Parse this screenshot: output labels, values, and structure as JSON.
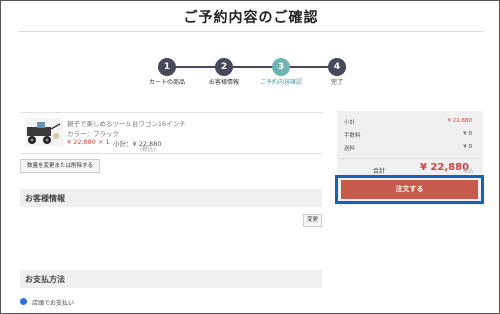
{
  "page_title": "ご予約内容のご確認",
  "steps": [
    {
      "number": "1",
      "label": "カートの商品",
      "current": false
    },
    {
      "number": "2",
      "label": "お客様情報",
      "current": false
    },
    {
      "number": "3",
      "label": "ご予約内容確認",
      "current": true
    },
    {
      "number": "4",
      "label": "完了",
      "current": false
    }
  ],
  "product": {
    "name_line1": "親子で楽しめるツール台ワゴン16インチ",
    "name_line2": "カラー：ブラック",
    "price_qty": "¥ 22,880 × 1",
    "subtotal": "小計：¥ 22,880",
    "tax_note": "(税込)"
  },
  "change_qty_button": "数量を変更または削除する",
  "customer_section": {
    "title": "お客様情報",
    "change_button": "変更"
  },
  "payment_section": {
    "title": "お支払方法",
    "option": "店頭でお支払い"
  },
  "summary": {
    "rows": [
      {
        "label": "小計",
        "value": "¥ 22,880",
        "red": true
      },
      {
        "label": "手数料",
        "value": "¥ 0",
        "red": false
      },
      {
        "label": "送料",
        "value": "¥ 0",
        "red": false
      }
    ],
    "total_label": "合計",
    "total_value": "¥ 22,880",
    "total_tax": "税込",
    "order_button": "注文する"
  },
  "colors": {
    "step_dark": "#47495a",
    "step_current": "#6fb3b3",
    "order_button": "#c75a4a",
    "price_red": "#cc4444",
    "highlight_blue": "#1563b6"
  }
}
